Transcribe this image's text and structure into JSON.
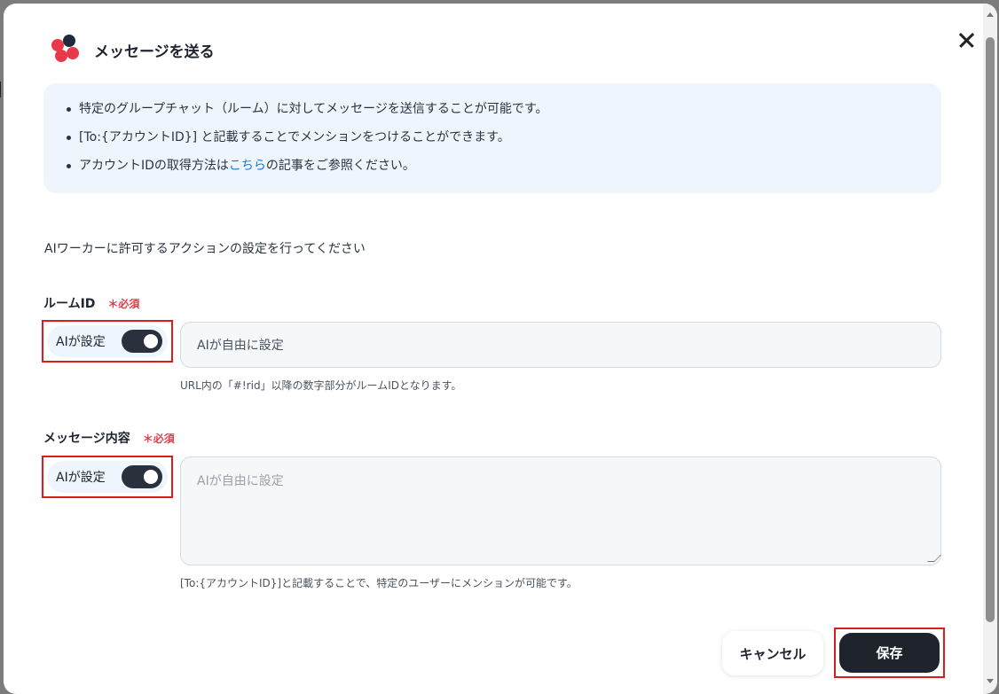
{
  "header": {
    "title": "メッセージを送る"
  },
  "info": {
    "line1": "特定のグループチャット（ルーム）に対してメッセージを送信することが可能です。",
    "line2": "[To:{アカウントID}] と記載することでメンションをつけることができます。",
    "line3_pre": "アカウントIDの取得方法は",
    "line3_link": "こちら",
    "line3_post": "の記事をご参照ください。"
  },
  "lead": "AIワーカーに許可するアクションの設定を行ってください",
  "fields": [
    {
      "label": "ルームID",
      "required": "＊必須",
      "ai_label": "AIが設定",
      "ai_enabled": true,
      "value": "AIが自由に設定",
      "hint": "URL内の「#!rid」以降の数字部分がルームIDとなります。"
    },
    {
      "label": "メッセージ内容",
      "required": "＊必須",
      "ai_label": "AIが設定",
      "ai_enabled": true,
      "placeholder": "AIが自由に設定",
      "hint": "[To:{アカウントID}]と記載することで、特定のユーザーにメンションが可能です。"
    }
  ],
  "footer": {
    "cancel_label": "キャンセル",
    "save_label": "保存"
  },
  "colors": {
    "accent": "#e8394b",
    "link": "#1a7ad9",
    "primary_button": "#1f242c",
    "info_bg": "#eef5fc"
  }
}
